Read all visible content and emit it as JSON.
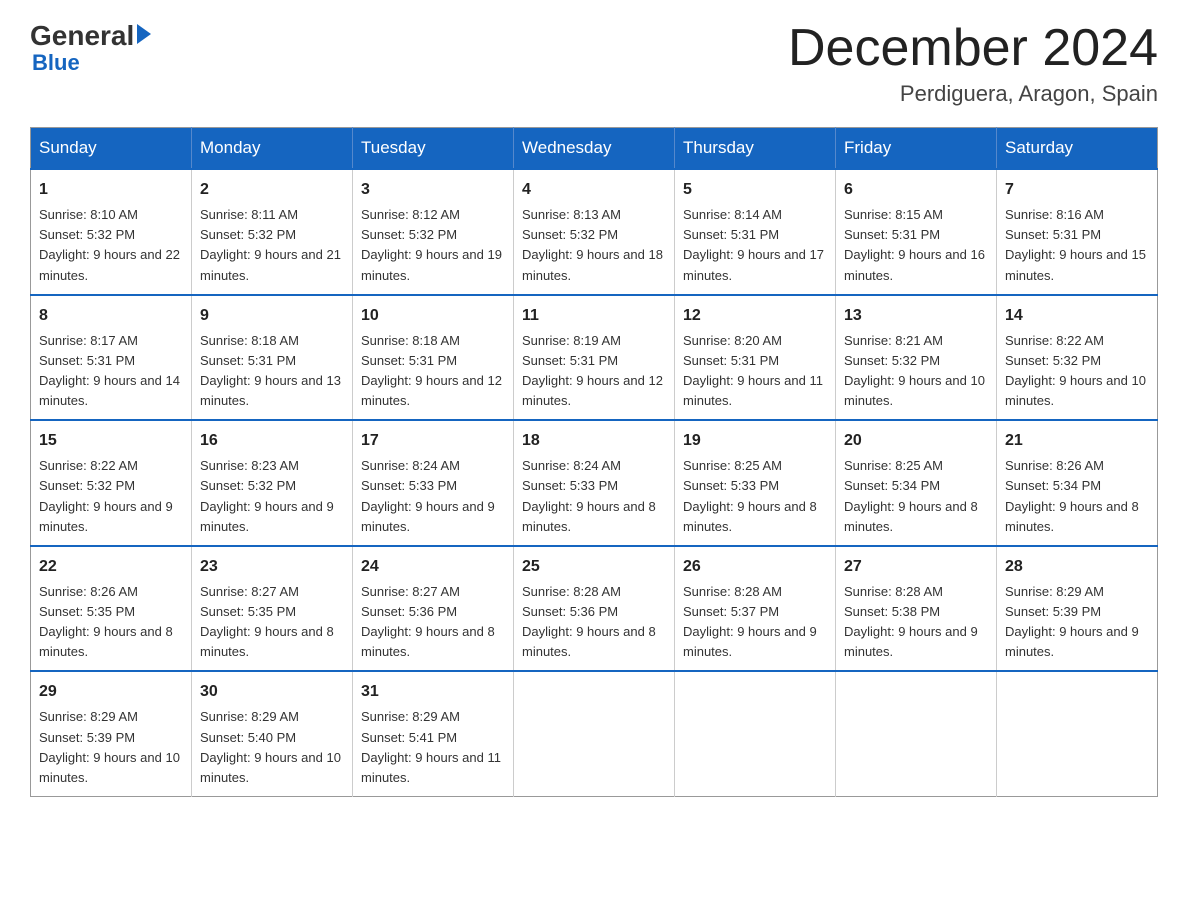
{
  "logo": {
    "general": "General",
    "triangle": "",
    "blue": "Blue"
  },
  "header": {
    "month": "December 2024",
    "location": "Perdiguera, Aragon, Spain"
  },
  "days_of_week": [
    "Sunday",
    "Monday",
    "Tuesday",
    "Wednesday",
    "Thursday",
    "Friday",
    "Saturday"
  ],
  "weeks": [
    [
      {
        "day": "1",
        "sunrise": "8:10 AM",
        "sunset": "5:32 PM",
        "daylight": "9 hours and 22 minutes."
      },
      {
        "day": "2",
        "sunrise": "8:11 AM",
        "sunset": "5:32 PM",
        "daylight": "9 hours and 21 minutes."
      },
      {
        "day": "3",
        "sunrise": "8:12 AM",
        "sunset": "5:32 PM",
        "daylight": "9 hours and 19 minutes."
      },
      {
        "day": "4",
        "sunrise": "8:13 AM",
        "sunset": "5:32 PM",
        "daylight": "9 hours and 18 minutes."
      },
      {
        "day": "5",
        "sunrise": "8:14 AM",
        "sunset": "5:31 PM",
        "daylight": "9 hours and 17 minutes."
      },
      {
        "day": "6",
        "sunrise": "8:15 AM",
        "sunset": "5:31 PM",
        "daylight": "9 hours and 16 minutes."
      },
      {
        "day": "7",
        "sunrise": "8:16 AM",
        "sunset": "5:31 PM",
        "daylight": "9 hours and 15 minutes."
      }
    ],
    [
      {
        "day": "8",
        "sunrise": "8:17 AM",
        "sunset": "5:31 PM",
        "daylight": "9 hours and 14 minutes."
      },
      {
        "day": "9",
        "sunrise": "8:18 AM",
        "sunset": "5:31 PM",
        "daylight": "9 hours and 13 minutes."
      },
      {
        "day": "10",
        "sunrise": "8:18 AM",
        "sunset": "5:31 PM",
        "daylight": "9 hours and 12 minutes."
      },
      {
        "day": "11",
        "sunrise": "8:19 AM",
        "sunset": "5:31 PM",
        "daylight": "9 hours and 12 minutes."
      },
      {
        "day": "12",
        "sunrise": "8:20 AM",
        "sunset": "5:31 PM",
        "daylight": "9 hours and 11 minutes."
      },
      {
        "day": "13",
        "sunrise": "8:21 AM",
        "sunset": "5:32 PM",
        "daylight": "9 hours and 10 minutes."
      },
      {
        "day": "14",
        "sunrise": "8:22 AM",
        "sunset": "5:32 PM",
        "daylight": "9 hours and 10 minutes."
      }
    ],
    [
      {
        "day": "15",
        "sunrise": "8:22 AM",
        "sunset": "5:32 PM",
        "daylight": "9 hours and 9 minutes."
      },
      {
        "day": "16",
        "sunrise": "8:23 AM",
        "sunset": "5:32 PM",
        "daylight": "9 hours and 9 minutes."
      },
      {
        "day": "17",
        "sunrise": "8:24 AM",
        "sunset": "5:33 PM",
        "daylight": "9 hours and 9 minutes."
      },
      {
        "day": "18",
        "sunrise": "8:24 AM",
        "sunset": "5:33 PM",
        "daylight": "9 hours and 8 minutes."
      },
      {
        "day": "19",
        "sunrise": "8:25 AM",
        "sunset": "5:33 PM",
        "daylight": "9 hours and 8 minutes."
      },
      {
        "day": "20",
        "sunrise": "8:25 AM",
        "sunset": "5:34 PM",
        "daylight": "9 hours and 8 minutes."
      },
      {
        "day": "21",
        "sunrise": "8:26 AM",
        "sunset": "5:34 PM",
        "daylight": "9 hours and 8 minutes."
      }
    ],
    [
      {
        "day": "22",
        "sunrise": "8:26 AM",
        "sunset": "5:35 PM",
        "daylight": "9 hours and 8 minutes."
      },
      {
        "day": "23",
        "sunrise": "8:27 AM",
        "sunset": "5:35 PM",
        "daylight": "9 hours and 8 minutes."
      },
      {
        "day": "24",
        "sunrise": "8:27 AM",
        "sunset": "5:36 PM",
        "daylight": "9 hours and 8 minutes."
      },
      {
        "day": "25",
        "sunrise": "8:28 AM",
        "sunset": "5:36 PM",
        "daylight": "9 hours and 8 minutes."
      },
      {
        "day": "26",
        "sunrise": "8:28 AM",
        "sunset": "5:37 PM",
        "daylight": "9 hours and 9 minutes."
      },
      {
        "day": "27",
        "sunrise": "8:28 AM",
        "sunset": "5:38 PM",
        "daylight": "9 hours and 9 minutes."
      },
      {
        "day": "28",
        "sunrise": "8:29 AM",
        "sunset": "5:39 PM",
        "daylight": "9 hours and 9 minutes."
      }
    ],
    [
      {
        "day": "29",
        "sunrise": "8:29 AM",
        "sunset": "5:39 PM",
        "daylight": "9 hours and 10 minutes."
      },
      {
        "day": "30",
        "sunrise": "8:29 AM",
        "sunset": "5:40 PM",
        "daylight": "9 hours and 10 minutes."
      },
      {
        "day": "31",
        "sunrise": "8:29 AM",
        "sunset": "5:41 PM",
        "daylight": "9 hours and 11 minutes."
      },
      null,
      null,
      null,
      null
    ]
  ]
}
